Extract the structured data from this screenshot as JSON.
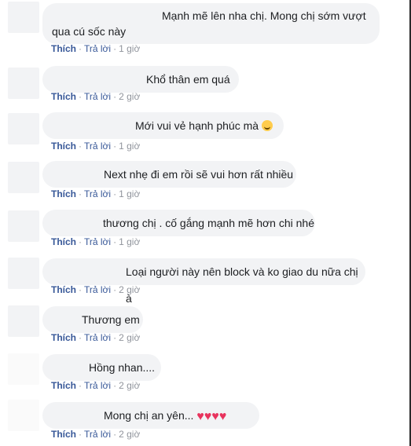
{
  "actions": {
    "like": "Thích",
    "reply": "Trả lời",
    "separator": "·"
  },
  "comments": [
    {
      "line1": "Mạnh mẽ lên nha chị. Mong chị sớm vượt",
      "line2": "qua cú sốc này",
      "time": "1 giờ"
    },
    {
      "text": "Khổ thân em quá",
      "time": "2 giờ"
    },
    {
      "text": "Mới vui vẻ hạnh phúc mà",
      "emoji": "crying-face",
      "time": "1 giờ"
    },
    {
      "text": "Next nhẹ đi em rồi sẽ vui hơn rất nhiều",
      "time": "1 giờ"
    },
    {
      "text": "thương chị . cố gắng mạnh mẽ hơn chi nhé",
      "time": "1 giờ"
    },
    {
      "text": "Loại người này nên block và ko giao du nữa chị à",
      "time": "2 giờ"
    },
    {
      "text": "Thương em",
      "time": "2 giờ"
    },
    {
      "text": "Hồng nhan....",
      "time": "2 giờ"
    },
    {
      "text": "Mong chị an yên...",
      "hearts": "♥♥♥♥",
      "time": "2 giờ"
    }
  ]
}
